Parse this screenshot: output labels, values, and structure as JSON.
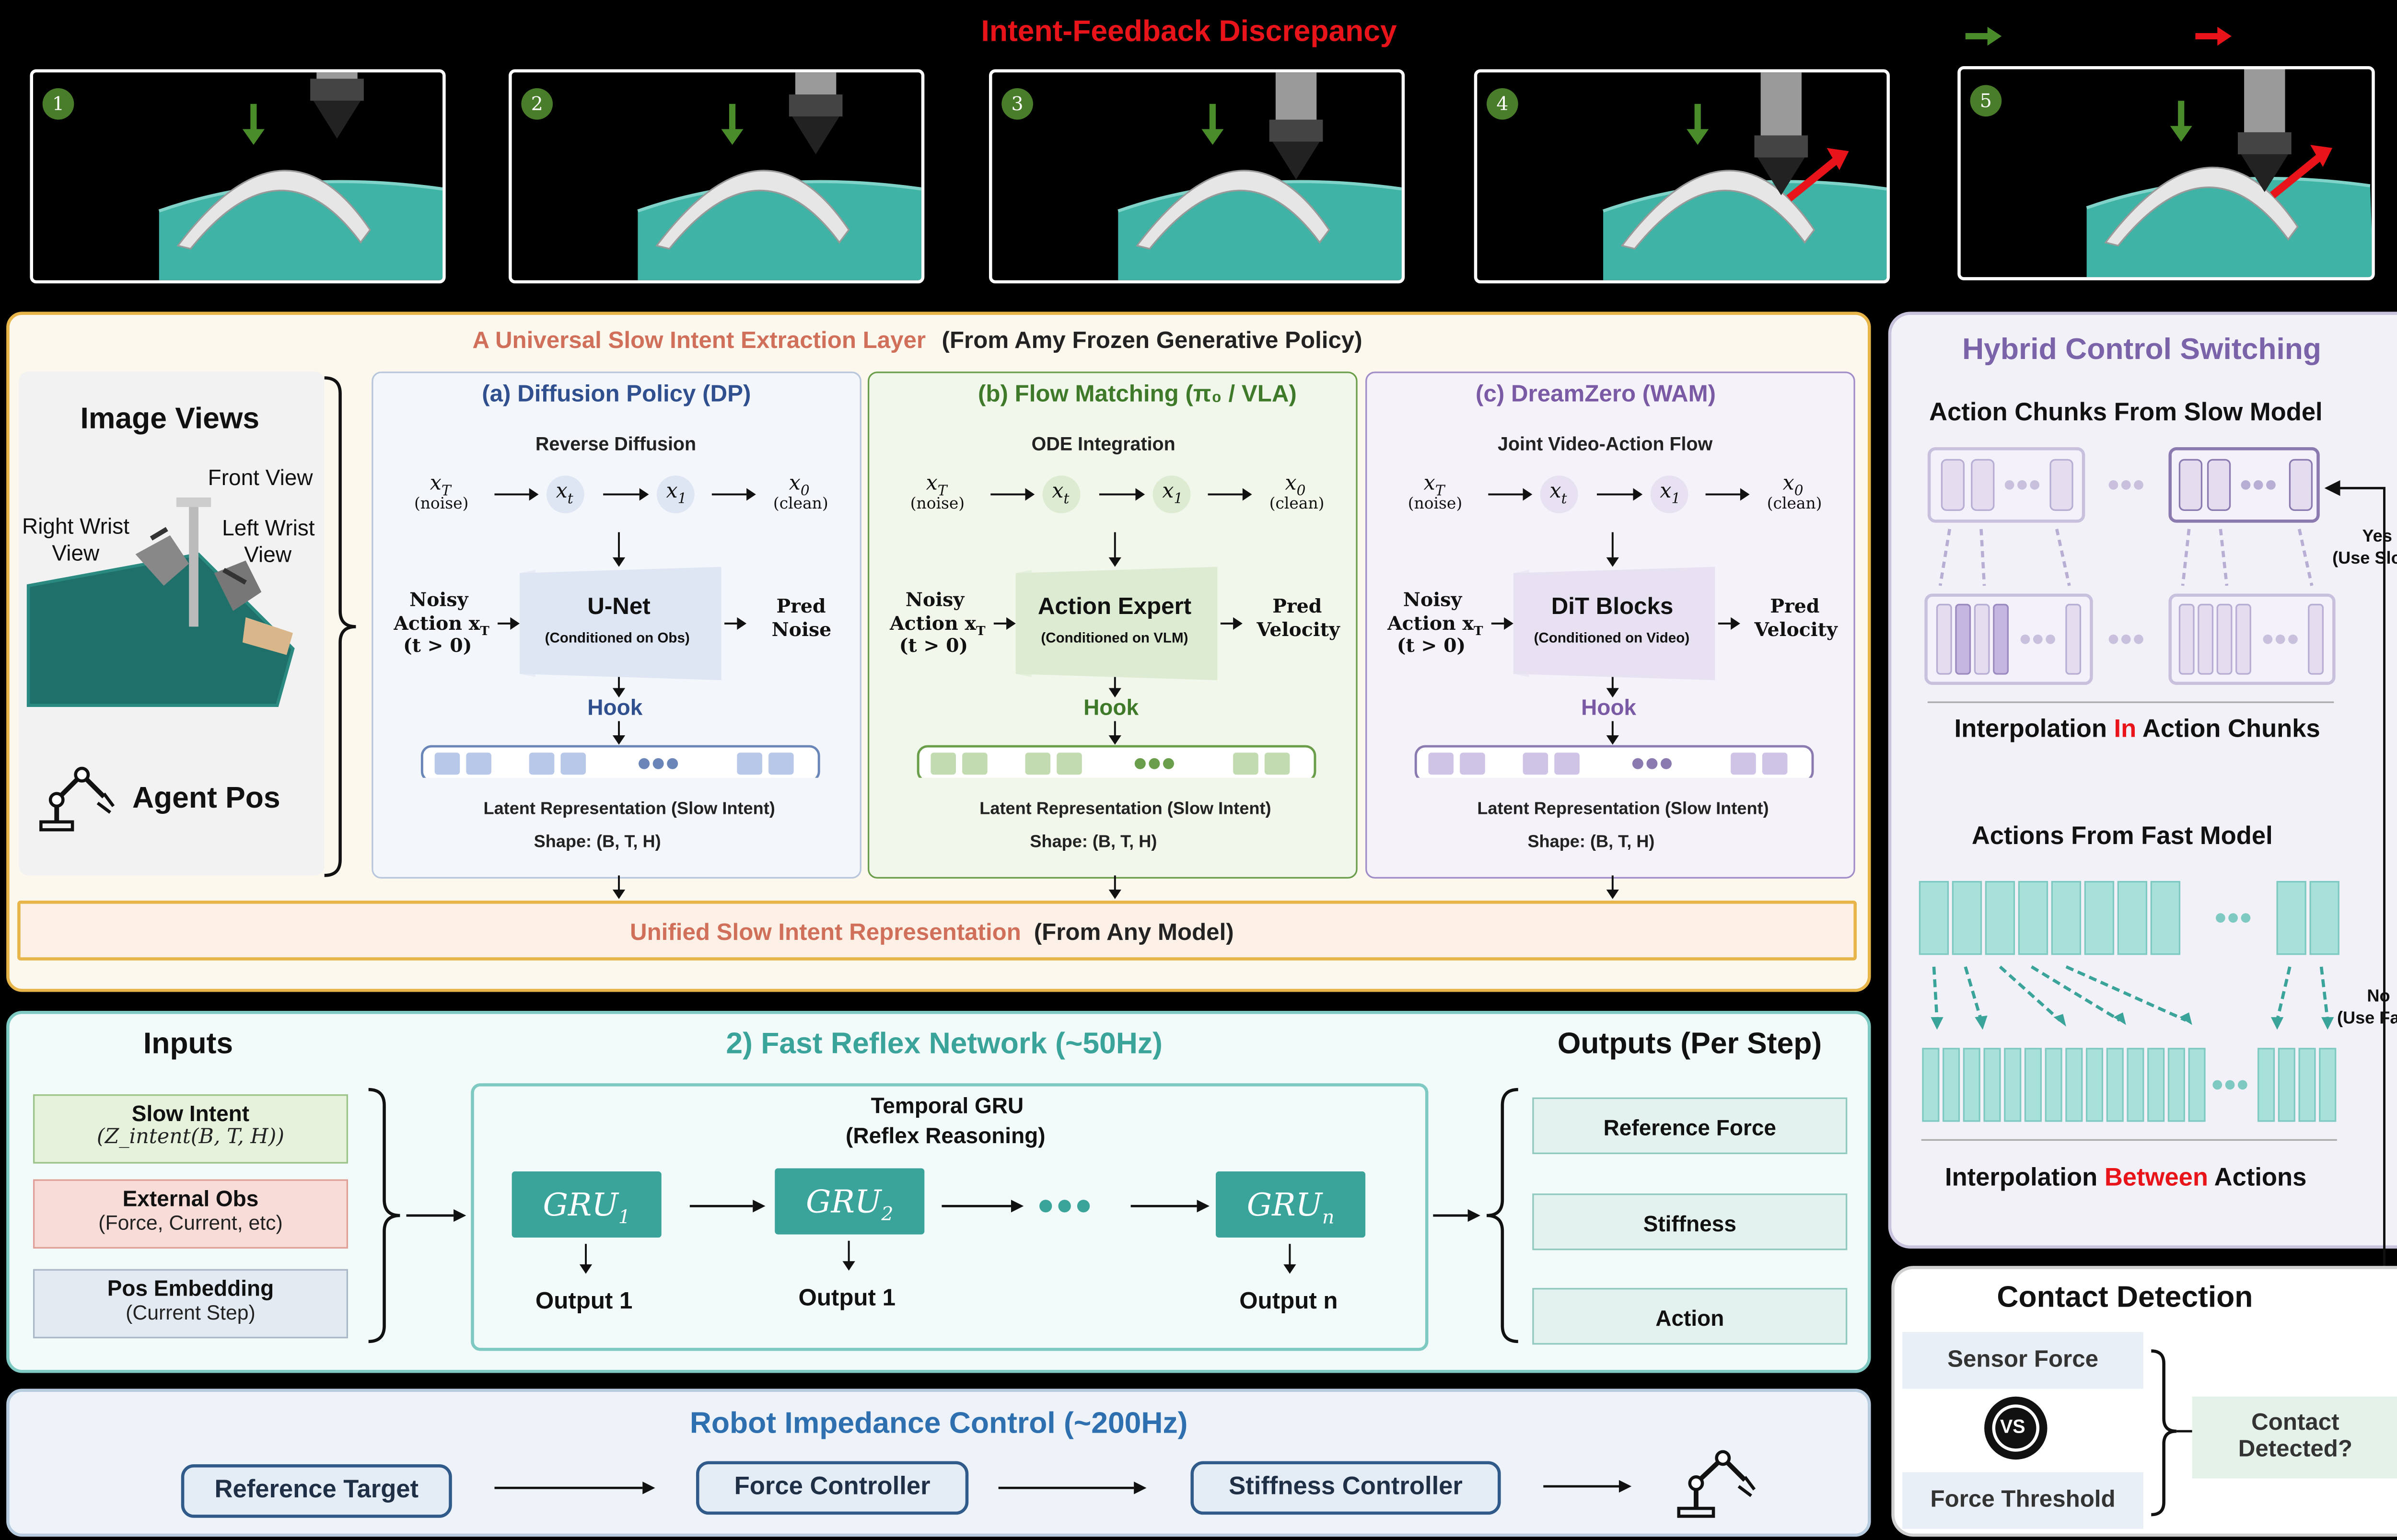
{
  "colors": {
    "discrepancy_red": "#e8141a",
    "arrow_green": "#4a8c2a",
    "slow_panel_bg": "#fdf8ee",
    "slow_panel_border": "#e8b54a",
    "dp_blue": "#2f4f8f",
    "fm_green": "#3f7a2a",
    "dz_purple": "#7a5aa5",
    "fast_teal": "#3aa39a",
    "impedance_blue": "#2e6fb0",
    "hybrid_purple": "#7a63a8"
  },
  "top": {
    "title": "Intent-Feedback Discrepancy",
    "legend": [
      "green-right-arrow-icon",
      "red-right-arrow-icon"
    ],
    "frames": [
      "1",
      "2",
      "3",
      "4",
      "5"
    ]
  },
  "slow": {
    "title": "A Universal Slow Intent Extraction Layer",
    "title_suffix": "(From Amy Frozen Generative Policy)",
    "image_views": "Image Views",
    "front_view": "Front View",
    "right_wrist": "Right Wrist",
    "right_wrist_2": "View",
    "left_wrist": "Left Wrist",
    "left_wrist_2": "View",
    "agent_pos": "Agent Pos",
    "columns": [
      {
        "title": "(a) Diffusion Policy (DP)",
        "process": "Reverse Diffusion",
        "input_l1": "Noisy",
        "input_l2": "Action x",
        "input_l3": "(t > 0)",
        "block": "U-Net",
        "block_sub": "(Conditioned on Obs)",
        "out_l1": "Pred",
        "out_l2": "Noise",
        "hook": "Hook",
        "latent": "Latent Representation (Slow Intent)",
        "shape": "Shape: (B, T, H)"
      },
      {
        "title": "(b) Flow Matching (π₀ / VLA)",
        "process": "ODE Integration",
        "input_l1": "Noisy",
        "input_l2": "Action x",
        "input_l3": "(t > 0)",
        "block": "Action Expert",
        "block_sub": "(Conditioned on VLM)",
        "out_l1": "Pred",
        "out_l2": "Velocity",
        "hook": "Hook",
        "latent": "Latent Representation (Slow Intent)",
        "shape": "Shape: (B, T, H)"
      },
      {
        "title": "(c) DreamZero (WAM)",
        "process": "Joint Video-Action Flow",
        "input_l1": "Noisy",
        "input_l2": "Action x",
        "input_l3": "(t > 0)",
        "block": "DiT Blocks",
        "block_sub": "(Conditioned on Video)",
        "out_l1": "Pred",
        "out_l2": "Velocity",
        "hook": "Hook",
        "latent": "Latent Representation (Slow Intent)",
        "shape": "Shape: (B, T, H)"
      }
    ],
    "chain": {
      "xT": "x",
      "xT_sub": "T",
      "noise": "(noise)",
      "xt": "x",
      "xt_sub": "t",
      "x1": "x",
      "x1_sub": "1",
      "x0": "x",
      "x0_sub": "0",
      "clean": "(clean)"
    },
    "unified": "Unified Slow Intent Representation",
    "unified_suffix": "(From Any Model)"
  },
  "fast": {
    "inputs_title": "Inputs",
    "title": "2) Fast Reflex Network (~50Hz)",
    "outputs_title": "Outputs (Per Step)",
    "inputs": [
      {
        "l1": "Slow Intent",
        "l2": "(Z_intent(B, T, H))"
      },
      {
        "l1": "External Obs",
        "l2": "(Force, Current, etc)"
      },
      {
        "l1": "Pos Embedding",
        "l2": "(Current Step)"
      }
    ],
    "gru_title": "Temporal GRU",
    "gru_subtitle": "(Reflex Reasoning)",
    "grus": [
      {
        "label": "GRU",
        "sub": "1",
        "out": "Output 1"
      },
      {
        "label": "GRU",
        "sub": "2",
        "out": "Output 1"
      },
      {
        "label": "GRU",
        "sub": "n",
        "out": "Output n"
      }
    ],
    "outputs": [
      "Reference Force",
      "Stiffness",
      "Action"
    ]
  },
  "impedance": {
    "title": "Robot Impedance Control (~200Hz)",
    "steps": [
      "Reference Target",
      "Force Controller",
      "Stiffness Controller"
    ]
  },
  "hybrid": {
    "title": "Hybrid Control Switching",
    "chunks_title": "Action Chunks From Slow Model",
    "interp_in_pre": "Interpolation ",
    "interp_in_hl": "In",
    "interp_in_post": " Action Chunks",
    "fast_title": "Actions From Fast Model",
    "interp_between_pre": "Interpolation ",
    "interp_between_hl": "Between",
    "interp_between_post": " Actions",
    "yes_l1": "Yes",
    "yes_l2": "(Use Slow)",
    "no_l1": "No",
    "no_l2": "(Use Fast)"
  },
  "contact": {
    "title": "Contact Detection",
    "sensor": "Sensor Force",
    "vs": "VS",
    "threshold": "Force Threshold",
    "detected_l1": "Contact",
    "detected_l2": "Detected?"
  }
}
